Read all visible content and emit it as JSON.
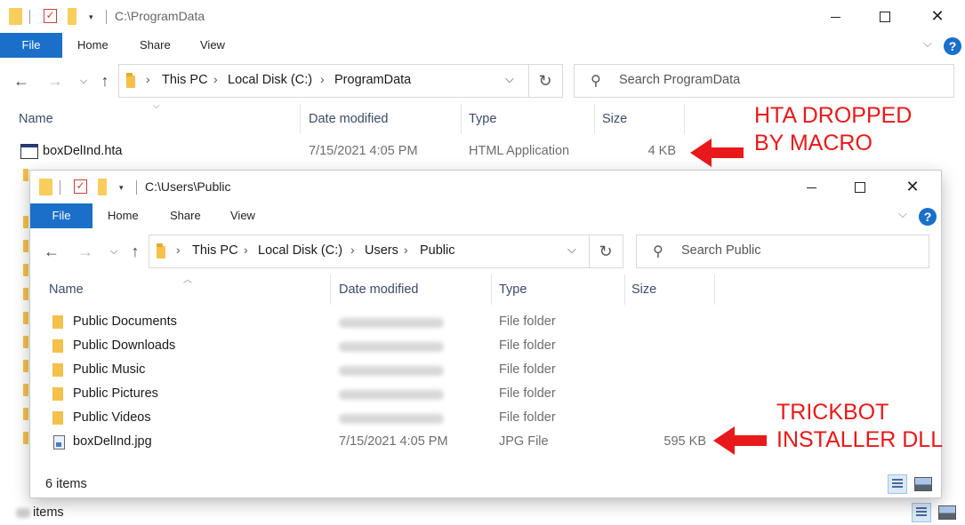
{
  "back_window": {
    "title_path": "C:\\ProgramData",
    "tabs": {
      "file": "File",
      "home": "Home",
      "share": "Share",
      "view": "View"
    },
    "breadcrumb": [
      "This PC",
      "Local Disk (C:)",
      "ProgramData"
    ],
    "search_placeholder": "Search ProgramData",
    "columns": {
      "name": "Name",
      "date": "Date modified",
      "type": "Type",
      "size": "Size"
    },
    "file": {
      "name": "boxDelInd.hta",
      "date": "7/15/2021 4:05 PM",
      "type": "HTML Application",
      "size": "4 KB"
    },
    "status_suffix": "items"
  },
  "front_window": {
    "title_path": "C:\\Users\\Public",
    "tabs": {
      "file": "File",
      "home": "Home",
      "share": "Share",
      "view": "View"
    },
    "breadcrumb": [
      "This PC",
      "Local Disk (C:)",
      "Users",
      "Public"
    ],
    "search_placeholder": "Search Public",
    "columns": {
      "name": "Name",
      "date": "Date modified",
      "type": "Type",
      "size": "Size"
    },
    "rows": [
      {
        "name": "Public Documents",
        "type": "File folder",
        "icon": "folder-icon"
      },
      {
        "name": "Public Downloads",
        "type": "File folder",
        "icon": "folder-icon"
      },
      {
        "name": "Public Music",
        "type": "File folder",
        "icon": "folder-icon"
      },
      {
        "name": "Public Pictures",
        "type": "File folder",
        "icon": "folder-icon"
      },
      {
        "name": "Public Videos",
        "type": "File folder",
        "icon": "folder-icon"
      },
      {
        "name": "boxDelInd.jpg",
        "date": "7/15/2021 4:05 PM",
        "type": "JPG File",
        "size": "595 KB",
        "icon": "image-file-icon"
      }
    ],
    "status": "6 items"
  },
  "annotations": {
    "hta_line1": "HTA DROPPED",
    "hta_line2": "BY MACRO",
    "dll_line1": "TRICKBOT",
    "dll_line2": "INSTALLER DLL",
    "color": "#e8191a"
  },
  "colors": {
    "accent": "#1a6fc9"
  }
}
